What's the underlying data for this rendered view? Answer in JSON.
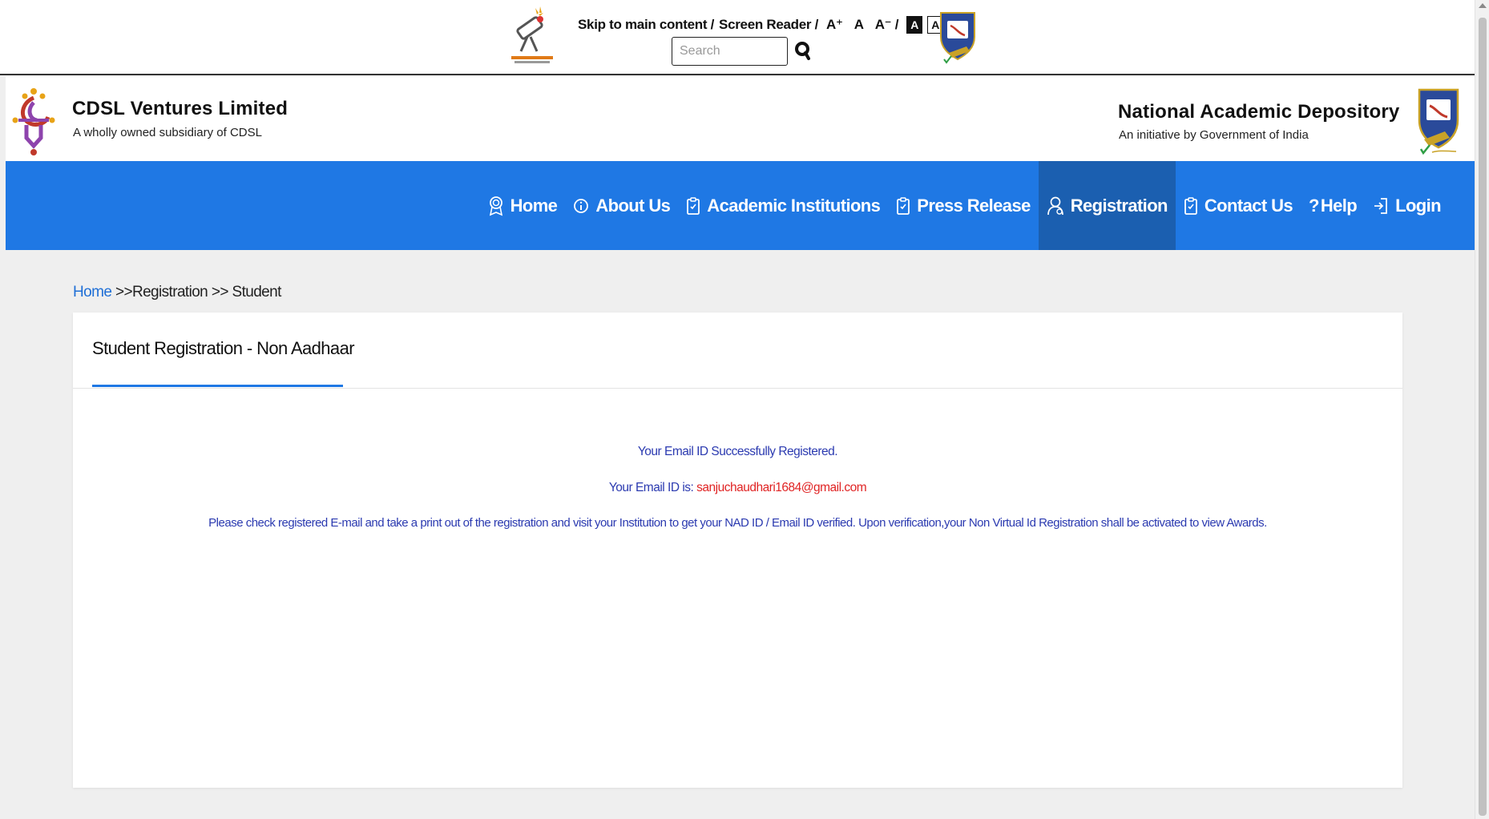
{
  "accessibility": {
    "skip_link": "Skip to main content /",
    "screen_reader": "Screen Reader /",
    "font_increase": "A⁺",
    "font_normal": "A",
    "font_decrease": "A⁻ /",
    "contrast_dark": "A",
    "contrast_light": "A",
    "search_placeholder": "Search"
  },
  "brand": {
    "left_title": "CDSL Ventures Limited",
    "left_subtitle": "A wholly owned subsidiary of CDSL",
    "right_title": "National Academic Depository",
    "right_subtitle": "An initiative by Government of India"
  },
  "nav": {
    "items": [
      {
        "label": "Home",
        "icon": "award-icon"
      },
      {
        "label": "About Us",
        "icon": "info-icon"
      },
      {
        "label": "Academic Institutions",
        "icon": "clipboard-icon"
      },
      {
        "label": "Press Release",
        "icon": "clipboard-icon"
      },
      {
        "label": "Registration",
        "icon": "user-icon",
        "active": true
      },
      {
        "label": "Contact Us",
        "icon": "clipboard-icon"
      },
      {
        "label": "Help",
        "icon": "question-icon"
      },
      {
        "label": "Login",
        "icon": "login-icon"
      }
    ]
  },
  "breadcrumb": {
    "home": "Home",
    "rest": " >>Registration >> Student"
  },
  "card": {
    "title": "Student Registration - Non Aadhaar",
    "message_success": "Your Email ID Successfully Registered.",
    "message_email_label": "Your Email ID is: ",
    "message_email_value": "sanjuchaudhari1684@gmail.com",
    "message_instruction": "Please check registered E-mail and take a print out of the registration and visit your Institution to get your NAD ID / Email ID verified. Upon verification,your Non Virtual Id Registration shall be activated to view Awards."
  },
  "colors": {
    "nav_background": "#1f78e4",
    "nav_active": "#1b5fb0",
    "message_text": "#2b3ab0",
    "email_text": "#e02424",
    "link": "#1f6fd6"
  }
}
